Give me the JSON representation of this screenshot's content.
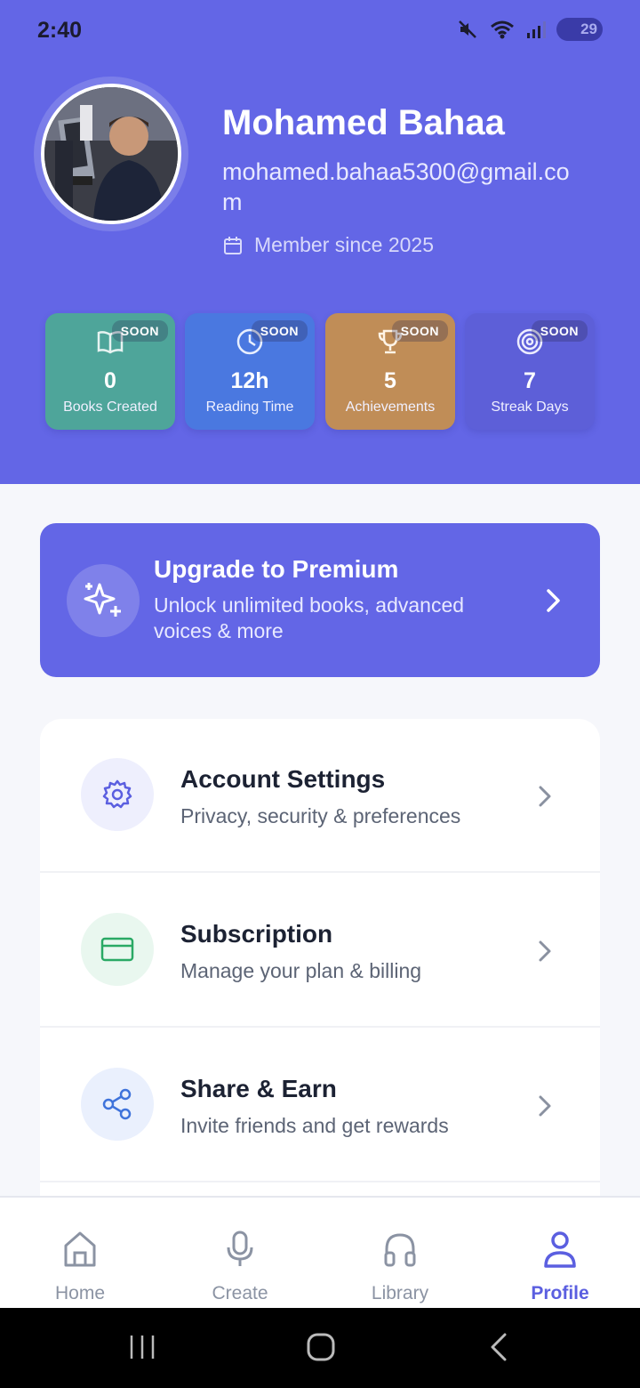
{
  "status_bar": {
    "time": "2:40",
    "battery": "29"
  },
  "profile": {
    "name": "Mohamed Bahaa",
    "email": "mohamed.bahaa5300@gmail.com",
    "member_since": "Member since 2025"
  },
  "stats": [
    {
      "badge": "SOON",
      "value": "0",
      "label": "Books Created",
      "icon": "book-open-icon",
      "color": "#4ea59a"
    },
    {
      "badge": "SOON",
      "value": "12h",
      "label": "Reading Time",
      "icon": "clock-icon",
      "color": "#4a78e0"
    },
    {
      "badge": "SOON",
      "value": "5",
      "label": "Achievements",
      "icon": "trophy-icon",
      "color": "#c08d57"
    },
    {
      "badge": "SOON",
      "value": "7",
      "label": "Streak Days",
      "icon": "target-icon",
      "color": "#5d5fd8"
    }
  ],
  "premium": {
    "title": "Upgrade to Premium",
    "subtitle": "Unlock unlimited books, advanced voices & more"
  },
  "menu": [
    {
      "title": "Account Settings",
      "subtitle": "Privacy, security & preferences",
      "icon": "gear-icon"
    },
    {
      "title": "Subscription",
      "subtitle": "Manage your plan & billing",
      "icon": "credit-card-icon"
    },
    {
      "title": "Share & Earn",
      "subtitle": "Invite friends and get rewards",
      "icon": "share-icon"
    }
  ],
  "nav": {
    "home": "Home",
    "create": "Create",
    "library": "Library",
    "profile": "Profile",
    "active": "profile"
  },
  "colors": {
    "accent": "#6366e6",
    "active_nav": "#5b5fe0"
  }
}
